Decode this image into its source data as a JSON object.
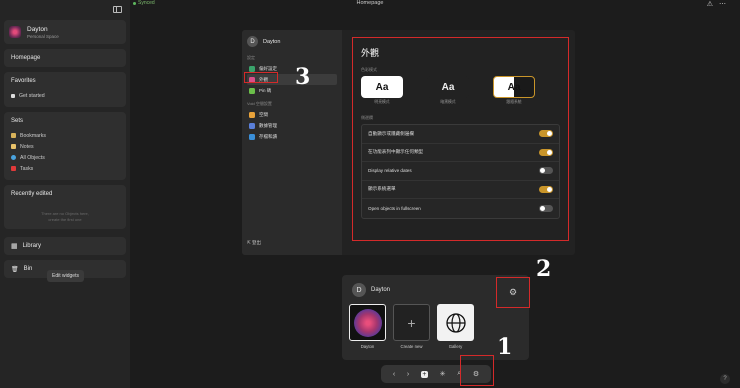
{
  "header": {
    "synced": "Synced",
    "title": "Homepage",
    "icons": [
      "alert-icon",
      "more-icon"
    ],
    "alert_glyph": "⚠",
    "more_glyph": "⋯"
  },
  "sidebar": {
    "space_name": "Dayton",
    "space_sub": "Personal Space",
    "homepage": "Homepage",
    "favorites_title": "Favorites",
    "get_started": "Get started",
    "sets_title": "Sets",
    "sets": [
      {
        "label": "Bookmarks",
        "color": "#d8b35a"
      },
      {
        "label": "Notes",
        "color": "#e8c26a"
      },
      {
        "label": "All Objects",
        "color": "#4aa3df"
      },
      {
        "label": "Tasks",
        "color": "#e03a3a"
      }
    ],
    "recent_title": "Recently edited",
    "recent_empty_1": "There are no Objects here,",
    "recent_empty_2": "create the first one",
    "library": "Library",
    "bin": "Bin",
    "edit_widgets": "Edit widgets"
  },
  "settings": {
    "user": "Dayton",
    "avatar_letter": "D",
    "head_settings": "設定",
    "items": [
      {
        "label": "偏好設定",
        "color": "#3aa36b"
      },
      {
        "label": "外觀",
        "color": "#d94f8a"
      },
      {
        "label": "Pin 碼",
        "color": "#6bbf4a"
      }
    ],
    "head_space": "Void 空間設置",
    "space_items": [
      {
        "label": "空間",
        "color": "#e8a23a"
      },
      {
        "label": "數據管理",
        "color": "#5a7fd9"
      },
      {
        "label": "存檔和讀",
        "color": "#3a8fd9"
      }
    ],
    "logout": "登出",
    "main_title": "外觀",
    "theme_head": "色彩模式",
    "themes": [
      {
        "label": "明亮模式",
        "glyph": "Aa"
      },
      {
        "label": "暗黑模式",
        "glyph": "Aa"
      },
      {
        "label": "跟隨系統",
        "glyph": "Aa"
      }
    ],
    "sidebar_head": "側邊欄",
    "toggles": [
      {
        "label": "自動顯示或隱藏側邊欄",
        "on": true
      },
      {
        "label": "在功能表列中顯示任何類型",
        "on": true
      },
      {
        "label": "Display relative dates",
        "on": false
      },
      {
        "label": "顯示系統選單",
        "on": true
      },
      {
        "label": "Open objects in fullscreen",
        "on": false
      }
    ]
  },
  "home_widget": {
    "user": "Dayton",
    "avatar_letter": "D",
    "gear_glyph": "⚙",
    "tiles": [
      {
        "label": "Dayton"
      },
      {
        "label": "Create new",
        "glyph": "+"
      },
      {
        "label": "Gallery"
      }
    ]
  },
  "bottombar": {
    "back": "‹",
    "forward": "›",
    "plus": "+",
    "graph": "✳",
    "search": "⌕",
    "gear": "⚙"
  },
  "help": "?",
  "markers": {
    "one": "1",
    "two": "2",
    "three": "3"
  }
}
